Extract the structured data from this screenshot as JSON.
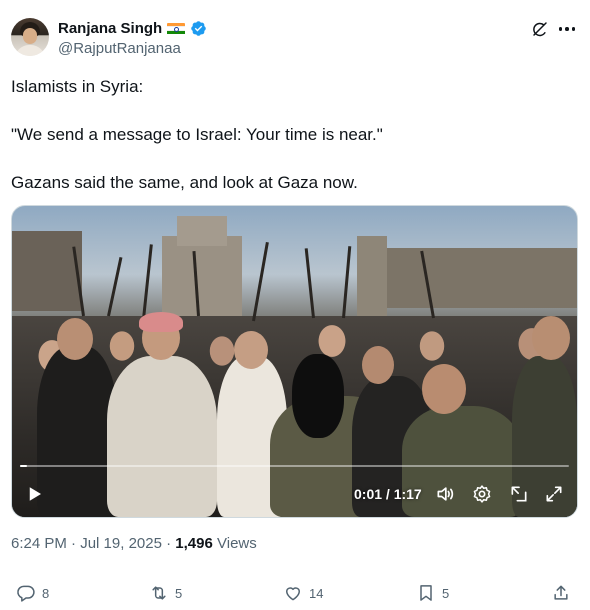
{
  "author": {
    "display_name": "Ranjana Singh",
    "handle": "@RajputRanjanaa",
    "flag": "india-flag-icon",
    "verified_badge": "verified-icon"
  },
  "tweet": {
    "line1": "Islamists in Syria:",
    "line2": "\"We send a message to Israel: Your time is near.\"",
    "line3": "Gazans said the same, and look at Gaza now."
  },
  "video": {
    "time_display": "0:01 / 1:17",
    "progress": 0.013,
    "controls": [
      "play-icon",
      "volume-icon",
      "settings-icon",
      "picture-in-picture-icon",
      "fullscreen-icon"
    ]
  },
  "meta": {
    "time": "6:24 PM",
    "separator": "·",
    "date": "Jul 19, 2025",
    "views_count": "1,496",
    "views_label": "Views"
  },
  "actions": {
    "replies": "8",
    "reposts": "5",
    "likes": "14",
    "bookmarks": "5"
  },
  "colors": {
    "text": "#0f1419",
    "secondary": "#536471",
    "verified": "#1d9bf0"
  }
}
